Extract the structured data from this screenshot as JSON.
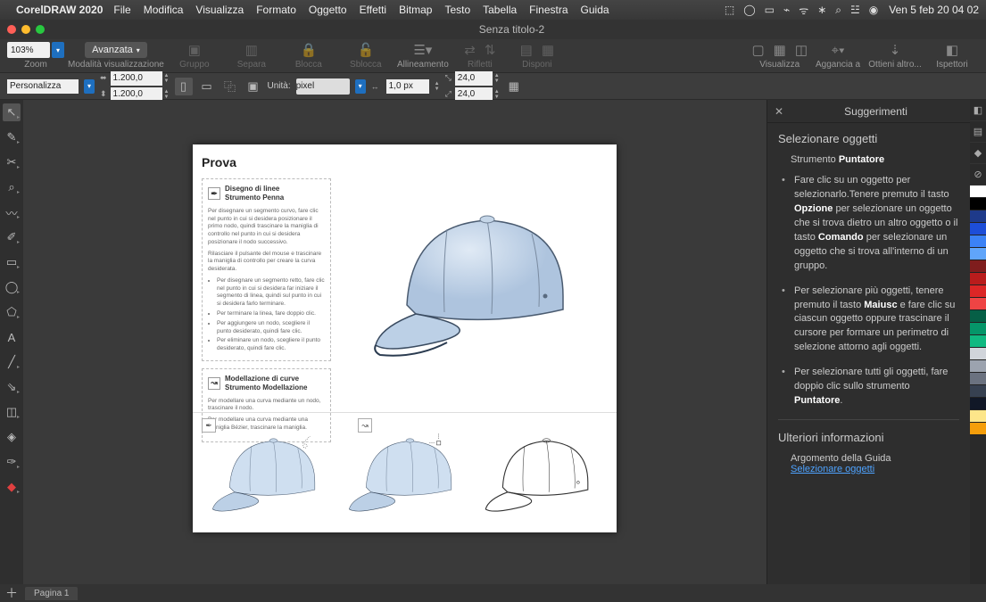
{
  "menubar": {
    "app": "CorelDRAW 2020",
    "items": [
      "File",
      "Modifica",
      "Visualizza",
      "Formato",
      "Oggetto",
      "Effetti",
      "Bitmap",
      "Testo",
      "Tabella",
      "Finestra",
      "Guida"
    ],
    "clock": "Ven 5 feb  20 04 02"
  },
  "title": "Senza titolo-2",
  "toolbar1": {
    "zoom_value": "103%",
    "zoom_label": "Zoom",
    "view_mode": "Avanzata",
    "view_mode_label": "Modalità visualizzazione",
    "groups": {
      "gruppo": "Gruppo",
      "separa": "Separa",
      "blocca": "Blocca",
      "sblocca": "Sblocca",
      "allineamento": "Allineamento",
      "rifletti": "Rifletti",
      "disponi": "Disponi",
      "visualizza": "Visualizza",
      "aggancia": "Aggancia a",
      "ottieni": "Ottieni altro...",
      "ispettori": "Ispettori"
    }
  },
  "toolbar2": {
    "preset": "Personalizza",
    "page_w": "1.200,0",
    "page_h": "1.200,0",
    "unit_label": "Unità:",
    "unit_value": "pixel",
    "nudge": "1,0 px",
    "dup_x": "24,0",
    "dup_y": "24,0"
  },
  "docker": {
    "title": "Suggerimenti",
    "h3": "Selezionare oggetti",
    "subtitle_pre": "Strumento ",
    "subtitle_bold": "Puntatore",
    "bullets": [
      {
        "pre": "Fare clic su un oggetto per selezionarlo.Tenere premuto il tasto ",
        "b1": "Opzione",
        "mid": " per selezionare un oggetto che si trova dietro un altro oggetto o il tasto ",
        "b2": "Comando",
        "post": " per selezionare un oggetto che si trova all'interno di un gruppo."
      },
      {
        "pre": "Per selezionare più oggetti, tenere premuto il tasto ",
        "b1": "Maiusc",
        "mid": " e fare clic su ciascun oggetto oppure trascinare il cursore per formare un perimetro di selezione attorno agli oggetti.",
        "b2": "",
        "post": ""
      },
      {
        "pre": "Per selezionare tutti gli oggetti, fare doppio clic sullo strumento ",
        "b1": "Puntatore",
        "mid": ".",
        "b2": "",
        "post": ""
      }
    ],
    "more_h": "Ulteriori informazioni",
    "more_sub": "Argomento della Guida",
    "more_link": "Selezionare oggetti"
  },
  "page_panel": {
    "title": "Prova",
    "sec1_t1": "Disegno di linee",
    "sec1_t2": "Strumento Penna",
    "sec1_p1": "Per disegnare un segmento curvo, fare clic nel punto in cui si desidera posizionare il primo nodo, quindi trascinare la maniglia di controllo nel punto in cui si desidera posizionare il nodo successivo.",
    "sec1_p2": "Rilasciare il pulsante del mouse e trascinare la maniglia di controllo per creare la curva desiderata.",
    "sec1_li1": "Per disegnare un segmento retto, fare clic nel punto in cui si desidera far iniziare il segmento di linea, quindi sul punto in cui si desidera farlo terminare.",
    "sec1_li2": "Per terminare la linea, fare doppio clic.",
    "sec1_li3": "Per aggiungere un nodo, scegliere il punto desiderato, quindi fare clic.",
    "sec1_li4": "Per eliminare un nodo, scegliere il punto desiderato, quindi fare clic.",
    "sec2_t1": "Modellazione di curve",
    "sec2_t2": "Strumento Modellazione",
    "sec2_p1": "Per modellare una curva mediante un nodo, trascinare il nodo.",
    "sec2_p2": "Per modellare una curva mediante una maniglia Bézier, trascinare la maniglia."
  },
  "status": {
    "page_tab": "Pagina 1"
  },
  "swatches": [
    "#ffffff",
    "#000000",
    "#1e3a8a",
    "#1d4ed8",
    "#3b82f6",
    "#60a5fa",
    "#7f1d1d",
    "#b91c1c",
    "#dc2626",
    "#ef4444",
    "#065f46",
    "#059669",
    "#10b981",
    "#d1d5db",
    "#9ca3af",
    "#6b7280",
    "#374151",
    "#111827",
    "#fde68a",
    "#f59e0b"
  ]
}
